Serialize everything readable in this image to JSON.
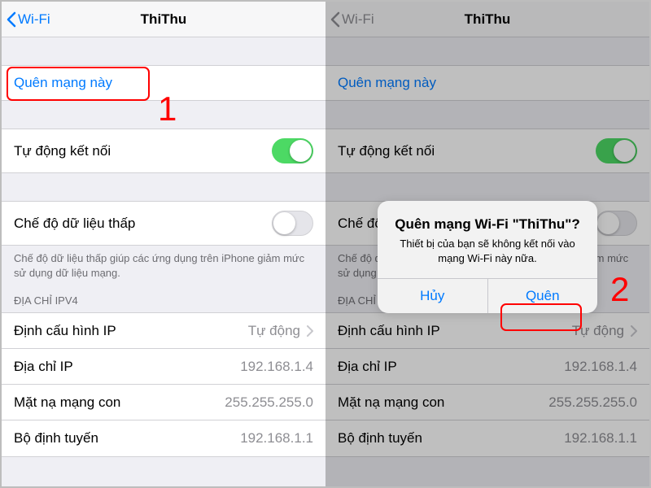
{
  "nav": {
    "back_label": "Wi-Fi",
    "title": "ThiThu"
  },
  "forget": {
    "label": "Quên mạng này"
  },
  "auto_join": {
    "label": "Tự động kết nối",
    "on": true
  },
  "low_data": {
    "label": "Chế độ dữ liệu thấp",
    "on": false,
    "note": "Chế độ dữ liệu thấp giúp các ứng dụng trên iPhone giảm mức sử dụng dữ liệu mạng."
  },
  "ipv4": {
    "header": "ĐỊA CHỈ IPV4",
    "rows": [
      {
        "label": "Định cấu hình IP",
        "value": "Tự động",
        "chevron": true
      },
      {
        "label": "Địa chỉ IP",
        "value": "192.168.1.4",
        "chevron": false
      },
      {
        "label": "Mặt nạ mạng con",
        "value": "255.255.255.0",
        "chevron": false
      },
      {
        "label": "Bộ định tuyến",
        "value": "192.168.1.1",
        "chevron": false
      }
    ]
  },
  "alert": {
    "title": "Quên mạng Wi-Fi \"ThiThu\"?",
    "message": "Thiết bị của bạn sẽ không kết nối vào mạng Wi-Fi này nữa.",
    "cancel": "Hủy",
    "confirm": "Quên"
  },
  "annot": {
    "one": "1",
    "two": "2"
  }
}
